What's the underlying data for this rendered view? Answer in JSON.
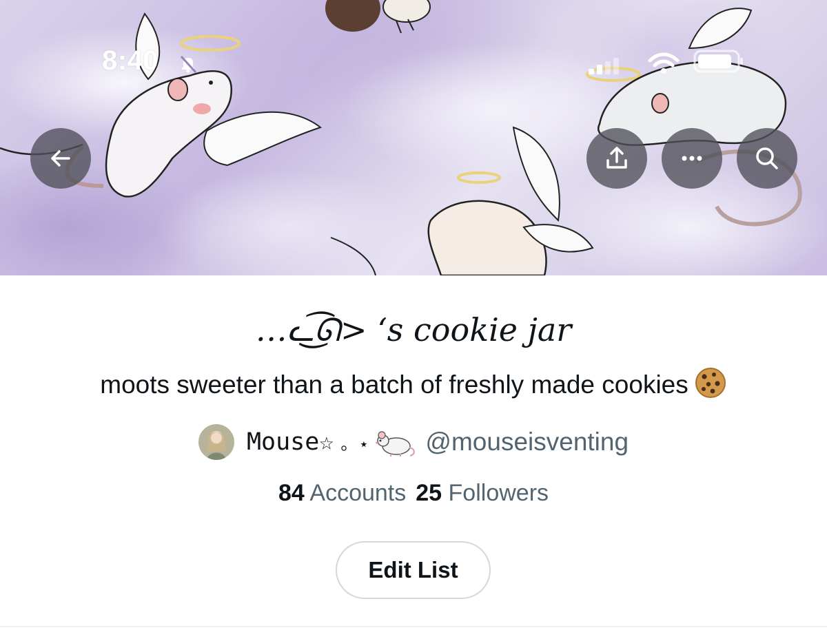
{
  "status_bar": {
    "time": "8:40"
  },
  "header": {
    "back_icon": "arrow-left-icon",
    "share_icon": "share-upload-icon",
    "more_icon": "more-horizontal-icon",
    "search_icon": "search-icon"
  },
  "list": {
    "title": "…ᓚ͜͡ᘏ> ‘s cookie jar",
    "description": "moots sweeter than a batch of freshly made cookies",
    "description_emoji": "cookie-icon",
    "owner": {
      "display_name": "Mouse☆",
      "decoration": "。⋆",
      "emoji": "mouse-icon",
      "handle": "@mouseisventing"
    },
    "stats": {
      "accounts_count": "84",
      "accounts_label": "Accounts",
      "followers_count": "25",
      "followers_label": "Followers"
    },
    "edit_button_label": "Edit List"
  },
  "colors": {
    "primary_text": "#0f1419",
    "secondary_text": "#536471",
    "button_border": "#cfd9de",
    "overlay_button": "#50505a"
  }
}
